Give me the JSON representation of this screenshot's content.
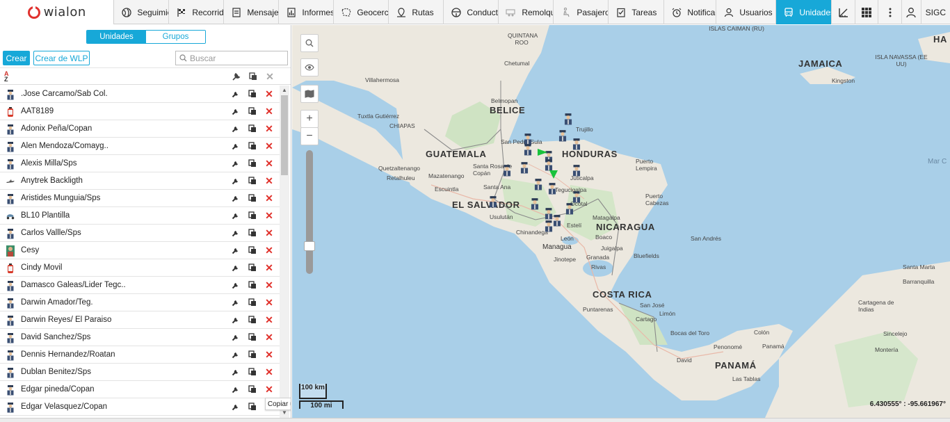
{
  "app": {
    "logo_text": "wialon"
  },
  "nav": [
    {
      "label": "Seguimiento",
      "icon": "globe-icon"
    },
    {
      "label": "Recorridos",
      "icon": "flag-icon"
    },
    {
      "label": "Mensajes",
      "icon": "messages-icon"
    },
    {
      "label": "Informes",
      "icon": "chart-icon"
    },
    {
      "label": "Geocercas",
      "icon": "geofence-icon"
    },
    {
      "label": "Rutas",
      "icon": "route-icon"
    },
    {
      "label": "Conductores",
      "icon": "steering-icon"
    },
    {
      "label": "Remolques",
      "icon": "trailer-icon"
    },
    {
      "label": "Pasajeros",
      "icon": "passenger-icon"
    },
    {
      "label": "Tareas",
      "icon": "tasks-icon"
    },
    {
      "label": "Notificaciones",
      "icon": "alarm-icon"
    },
    {
      "label": "Usuarios",
      "icon": "user-icon"
    },
    {
      "label": "Unidades",
      "icon": "bus-icon"
    }
  ],
  "user": {
    "name": "SIGC"
  },
  "panel": {
    "tab_units": "Unidades",
    "tab_groups": "Grupos",
    "create_label": "Crear",
    "create_wlp_label": "Crear de WLP",
    "search_placeholder": "Buscar",
    "sort_top": "A",
    "sort_bottom": "Z",
    "units": [
      {
        "name": ".Jose Carcamo/Sab Col.",
        "icon": "officer"
      },
      {
        "name": "AAT8189",
        "icon": "extinguisher"
      },
      {
        "name": "Adonix Peña/Copan",
        "icon": "officer"
      },
      {
        "name": "Alen Mendoza/Comayg..",
        "icon": "officer"
      },
      {
        "name": "Alexis Milla/Sps",
        "icon": "officer"
      },
      {
        "name": "Anytrek Backligth",
        "icon": "plane"
      },
      {
        "name": "Aristides Munguia/Sps",
        "icon": "officer"
      },
      {
        "name": "BL10 Plantilla",
        "icon": "scooter"
      },
      {
        "name": "Carlos Vallle/Sps",
        "icon": "officer"
      },
      {
        "name": "Cesy",
        "icon": "person"
      },
      {
        "name": "Cindy Movil",
        "icon": "extinguisher"
      },
      {
        "name": "Damasco Galeas/Lider Tegc..",
        "icon": "officer"
      },
      {
        "name": "Darwin Amador/Teg.",
        "icon": "officer"
      },
      {
        "name": "Darwin Reyes/ El Paraiso",
        "icon": "officer"
      },
      {
        "name": "David Sanchez/Sps",
        "icon": "officer"
      },
      {
        "name": "Dennis Hernandez/Roatan",
        "icon": "officer"
      },
      {
        "name": "Dublan Benitez/Sps",
        "icon": "officer"
      },
      {
        "name": "Edgar pineda/Copan",
        "icon": "officer"
      },
      {
        "name": "Edgar Velasquez/Copan",
        "icon": "officer"
      }
    ],
    "tooltip": "Copiar unidad"
  },
  "map": {
    "scale_km": "100 km",
    "scale_mi": "100 mi",
    "coords": "6.430555° : -95.661967°",
    "labels": {
      "countries": [
        "GUATEMALA",
        "HONDURAS",
        "EL SALVADOR",
        "NICARAGUA",
        "COSTA RICA",
        "PANAMÁ",
        "BELICE",
        "JAMAICA"
      ],
      "regions": [
        "QUINTANA ROO",
        "CHIAPAS",
        "ISLAS CAIMAN (RU)",
        "ISLA NAVASSA (EE UU)",
        "HA",
        "Mar C"
      ],
      "cities": [
        "Villahermosa",
        "Chetumal",
        "Tuxtla Gutiérrez",
        "Belmopan",
        "Trujillo",
        "San Pedro Sula",
        "Santa Rosa de Copán",
        "Quetzaltenango",
        "Retalhuleu",
        "Mazatenango",
        "Escuintla",
        "Santa Ana",
        "Usulután",
        "Juticalpa",
        "Tegucigalpa",
        "Ocotal",
        "Estelí",
        "Puerto Lempira",
        "Puerto Cabezas",
        "Matagalpa",
        "Chinandega",
        "León",
        "Boaco",
        "Managua",
        "Juigalpa",
        "Jinotepe",
        "Granada",
        "Rivas",
        "Bluefields",
        "San Andrés",
        "Kingston",
        "Santa Marta",
        "Barranquilla",
        "Cartagena de Indias",
        "Sincelejo",
        "Montería",
        "Puntarenas",
        "San José",
        "Limón",
        "Cartago",
        "Bocas del Toro",
        "Colón",
        "Penonomé",
        "Panamá",
        "David",
        "Las Tablas"
      ]
    }
  }
}
